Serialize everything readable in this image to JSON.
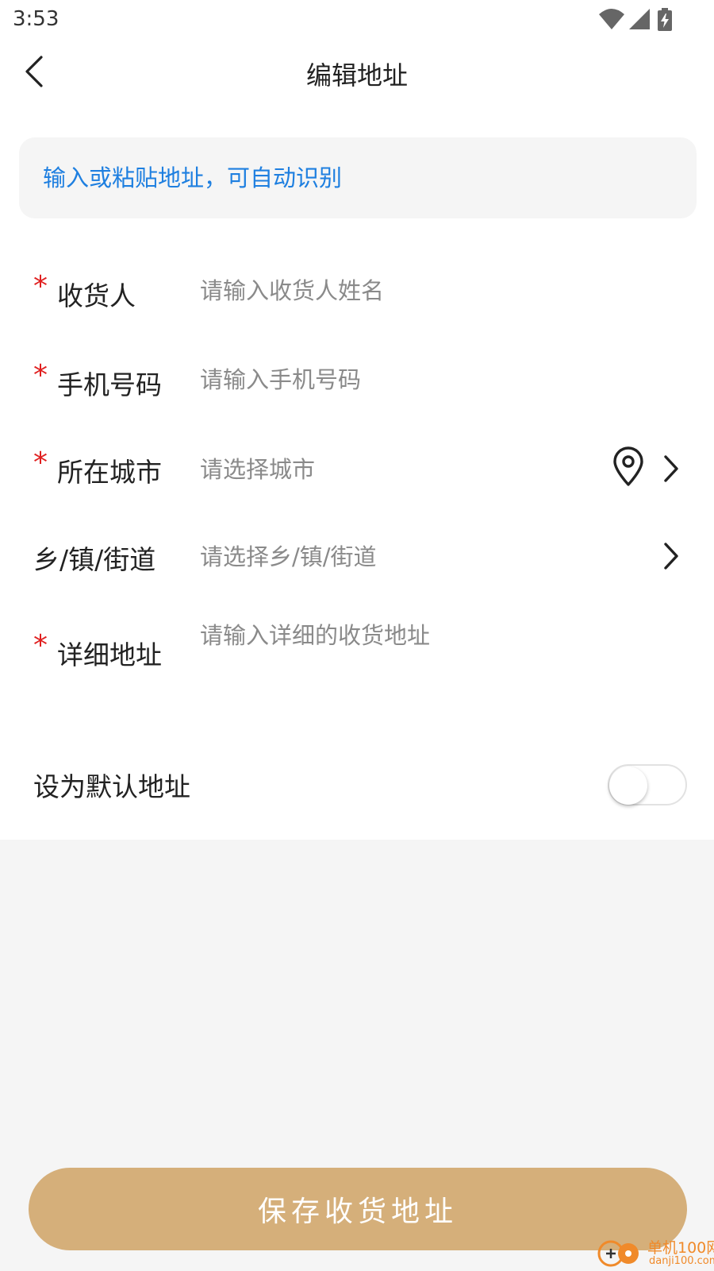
{
  "status_bar": {
    "time": "3:53"
  },
  "header": {
    "title": "编辑地址"
  },
  "paste_box": {
    "placeholder": "输入或粘贴地址，可自动识别"
  },
  "form": {
    "required_mark": "*",
    "receiver": {
      "label": "收货人",
      "placeholder": "请输入收货人姓名"
    },
    "phone": {
      "label": "手机号码",
      "placeholder": "请输入手机号码"
    },
    "city": {
      "label": "所在城市",
      "placeholder": "请选择城市"
    },
    "town": {
      "label": "乡/镇/街道",
      "placeholder": "请选择乡/镇/街道"
    },
    "detail": {
      "label": "详细地址",
      "placeholder": "请输入详细的收货地址"
    }
  },
  "default_address": {
    "label": "设为默认地址",
    "enabled": false
  },
  "save_button": {
    "label": "保存收货地址"
  },
  "watermark": {
    "line1": "单机100网",
    "line2": "danji100.com"
  },
  "colors": {
    "accent": "#d5af7a",
    "link": "#1e7fe0",
    "required": "#e02020",
    "placeholder": "#8a8a8a",
    "page_bg": "#f5f5f5"
  },
  "icons": {
    "back": "chevron-left-icon",
    "wifi": "wifi-icon",
    "signal": "signal-icon",
    "battery": "battery-charging-icon",
    "location": "location-pin-icon",
    "chevron": "chevron-right-icon"
  }
}
